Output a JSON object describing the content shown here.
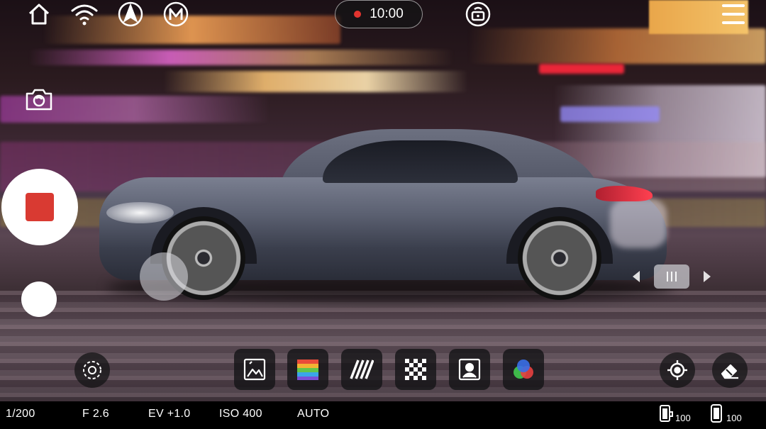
{
  "recording": {
    "timer": "10:00"
  },
  "params": {
    "shutter": "1/200",
    "aperture": "F 2.6",
    "exposure": "EV +1.0",
    "iso": "ISO 400",
    "white_balance": "AUTO"
  },
  "batteries": {
    "camera": "100",
    "phone": "100"
  },
  "icons": {
    "top_bar": [
      "home-icon",
      "wifi-icon",
      "navigation-arrow-icon",
      "mode-m-icon",
      "gimbal-remote-icon",
      "menu-icon"
    ],
    "left": [
      "camera-switch-icon"
    ],
    "bottom_left": [
      "target-dial-icon"
    ],
    "filters": [
      "landscape-filter-icon",
      "rainbow-color-icon",
      "zebra-stripes-icon",
      "checkerboard-icon",
      "portrait-icon",
      "rgb-circles-icon"
    ],
    "bottom_right": [
      "focus-crosshair-icon",
      "eraser-icon"
    ]
  },
  "colors": {
    "record_red": "#d93a32",
    "rec_dot": "#e3342f"
  }
}
